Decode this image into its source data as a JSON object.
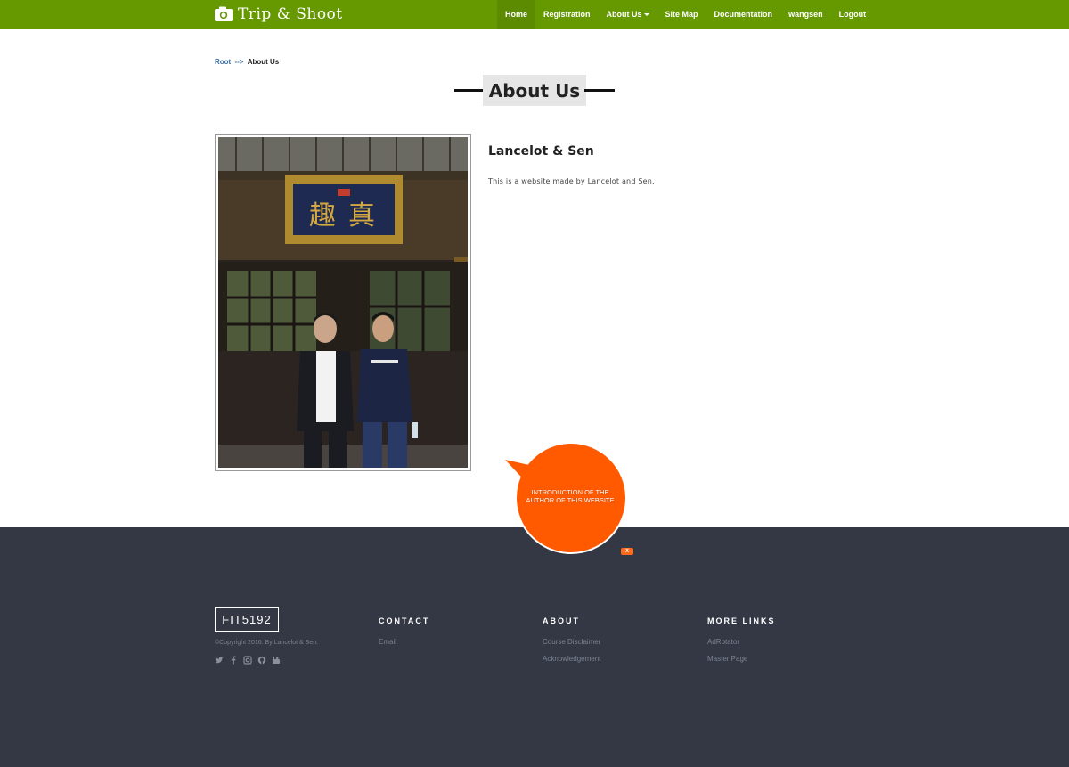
{
  "brand": {
    "title": "Trip & Shoot",
    "icon": "camera-icon"
  },
  "nav": {
    "items": [
      {
        "label": "Home",
        "active": true
      },
      {
        "label": "Registration"
      },
      {
        "label": "About Us",
        "dropdown": true
      },
      {
        "label": "Site Map"
      },
      {
        "label": "Documentation"
      },
      {
        "label": "wangsen"
      },
      {
        "label": "Logout"
      }
    ]
  },
  "breadcrumb": {
    "root": "Root",
    "separator": "-->",
    "current": "About Us"
  },
  "page": {
    "title": "About Us"
  },
  "profile": {
    "name": "Lancelot & Sen",
    "description": "This is a website made by Lancelot and Sen."
  },
  "ad": {
    "text": "INTRODUCTION OF THE AUTHOR OF THIS WEBSITE",
    "close_label": "X",
    "color": "#ff5a00"
  },
  "footer": {
    "logo": "FIT5192",
    "copyright": "©Copyright 2016. By Lancelot & Sen.",
    "social_icons": [
      "twitter-icon",
      "facebook-icon",
      "instagram-icon",
      "github-icon",
      "youtube-icon"
    ],
    "columns": [
      {
        "title": "CONTACT",
        "links": [
          "Email"
        ]
      },
      {
        "title": "ABOUT",
        "links": [
          "Course Disclaimer",
          "Acknowledgement"
        ]
      },
      {
        "title": "MORE LINKS",
        "links": [
          "AdRotator",
          "Master Page"
        ]
      }
    ]
  },
  "colors": {
    "nav_bg": "#669900",
    "footer_bg": "#333844",
    "accent": "#ff5a00"
  }
}
